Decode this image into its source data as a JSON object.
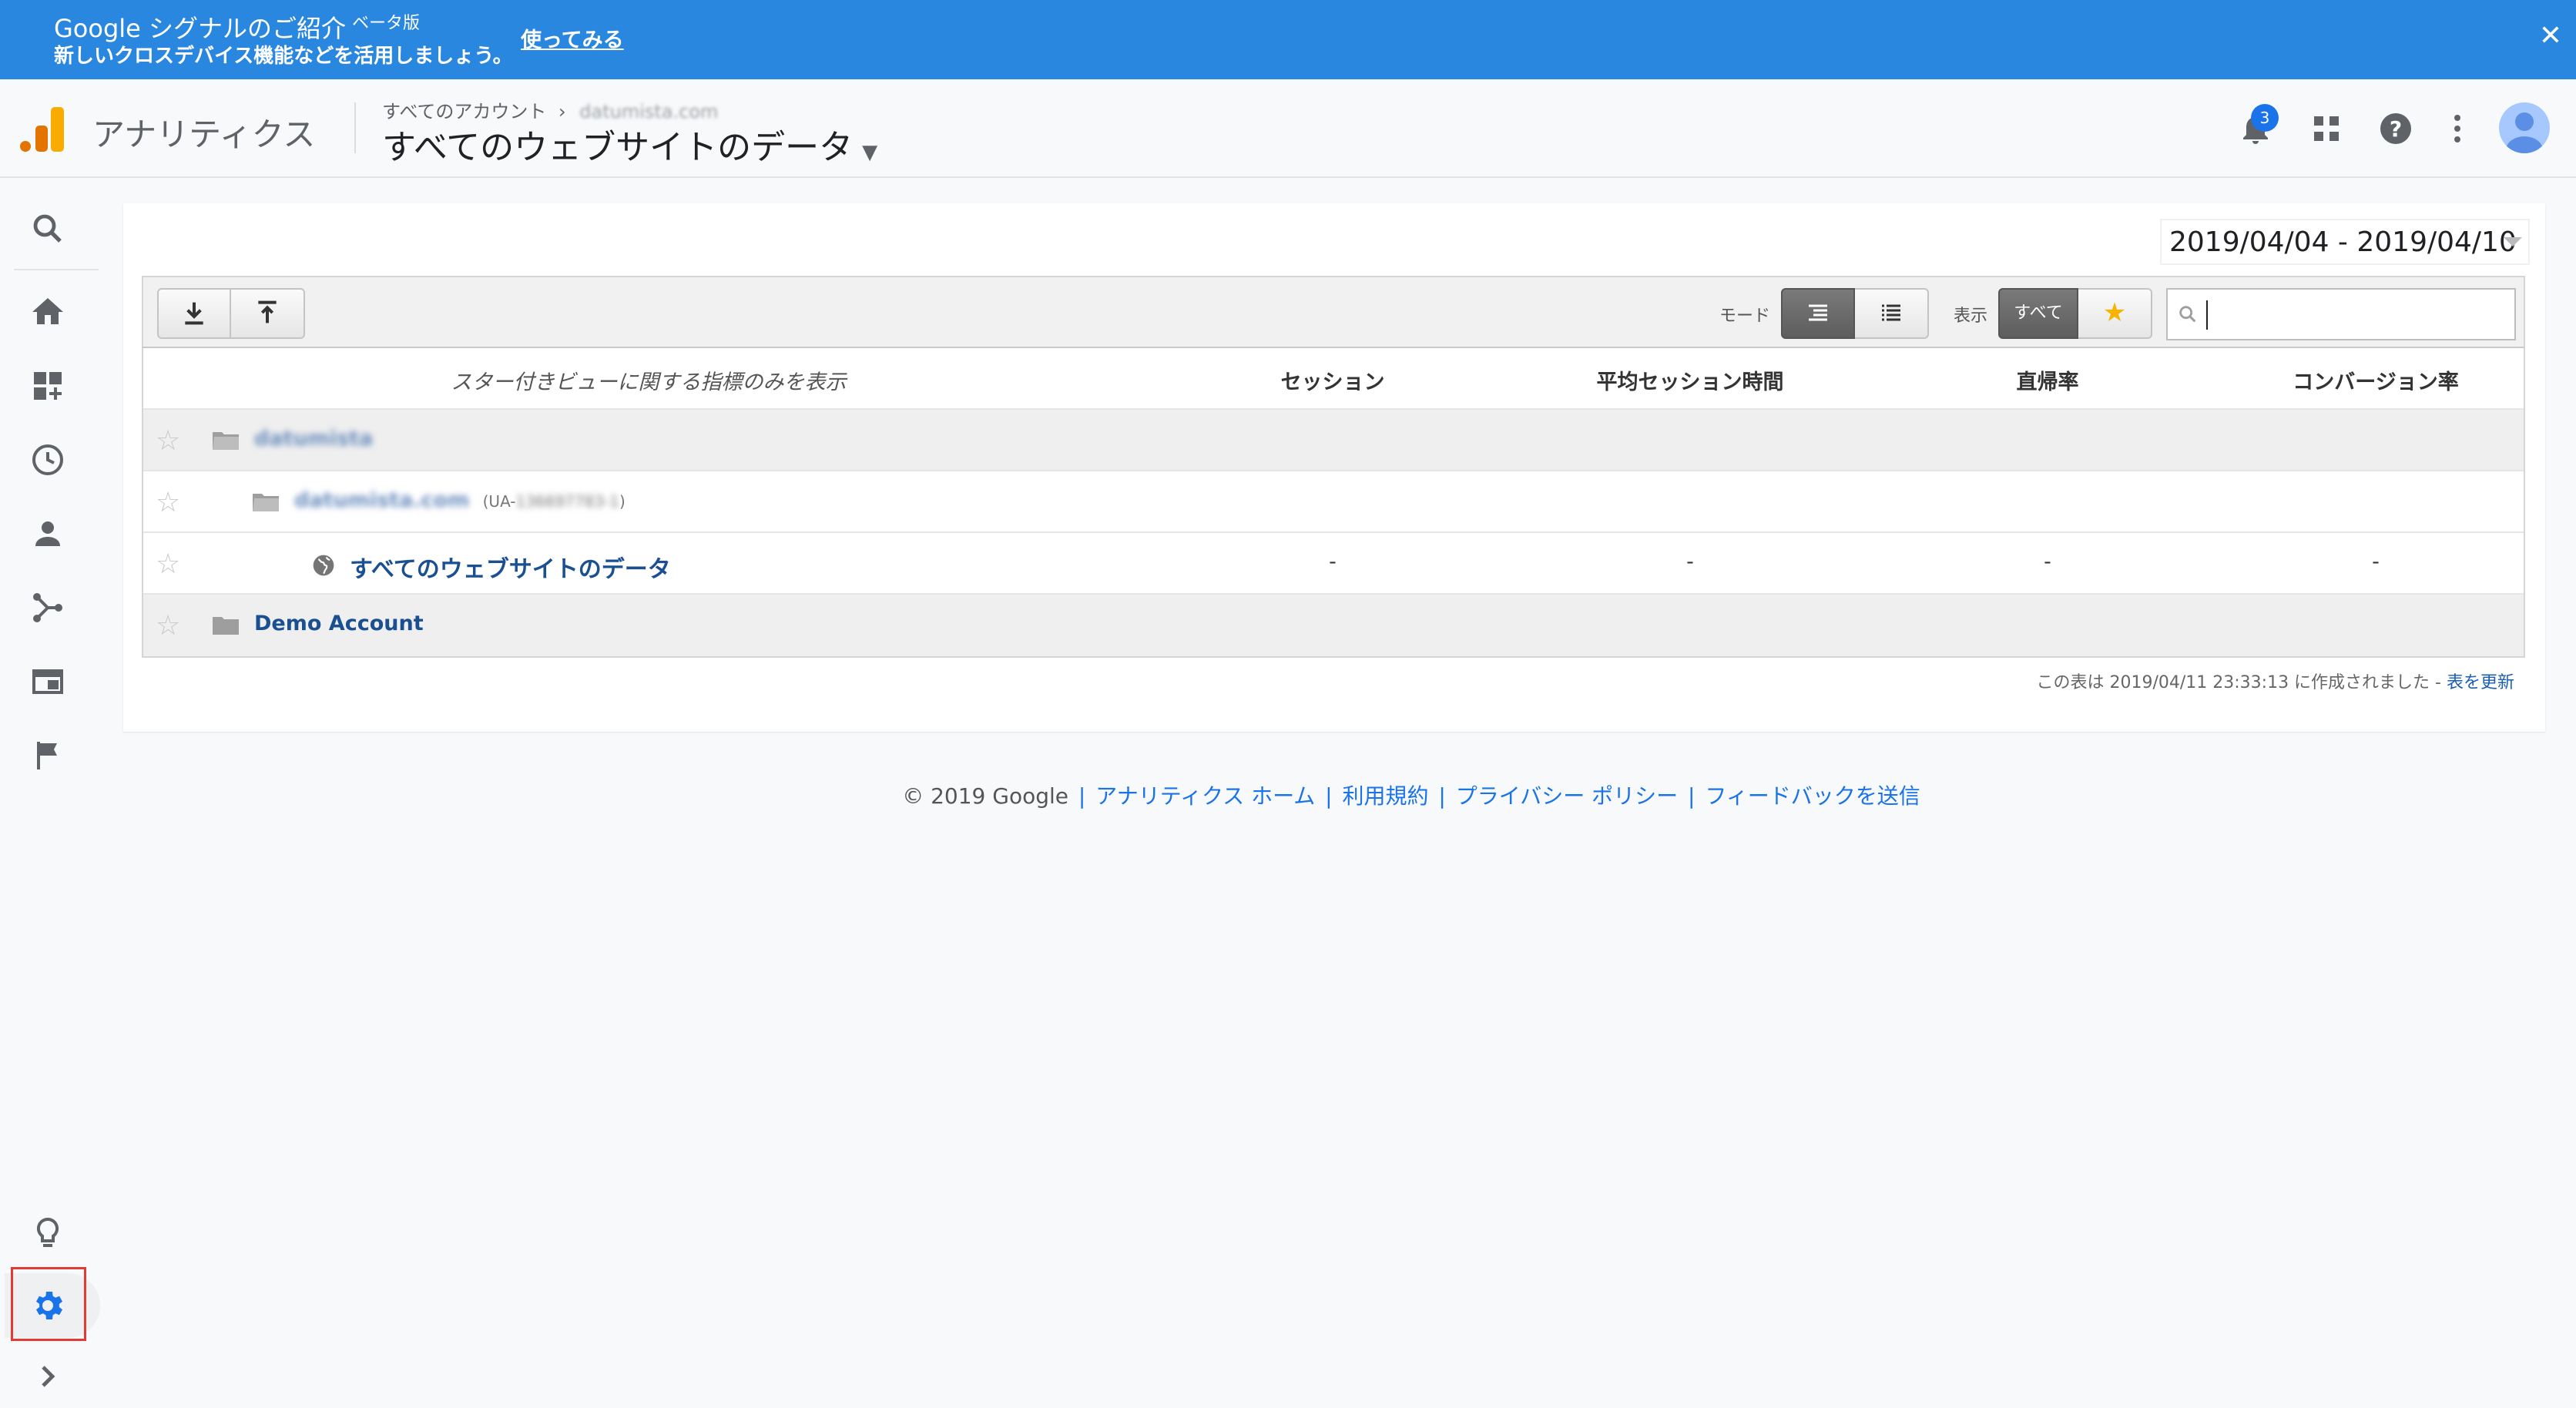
{
  "banner": {
    "title": "Google シグナルのご紹介",
    "beta": "ベータ版",
    "subtitle": "新しいクロスデバイス機能などを活用しましょう。",
    "cta": "使ってみる",
    "close": "✕"
  },
  "header": {
    "app_name": "アナリティクス",
    "breadcrumb_root": "すべてのアカウント",
    "breadcrumb_sep": "›",
    "breadcrumb_account": "datumista.com",
    "view_title": "すべてのウェブサイトのデータ",
    "notification_count": "3"
  },
  "date_range": "2019/04/04 - 2019/04/10",
  "toolbar": {
    "mode_label": "モード",
    "show_label": "表示",
    "show_all": "すべて",
    "search_placeholder": ""
  },
  "table": {
    "hint": "スター付きビューに関する指標のみを表示",
    "columns": [
      "セッション",
      "平均セッション時間",
      "直帰率",
      "コンバージョン率"
    ],
    "rows": [
      {
        "name": "datumista",
        "type": "account"
      },
      {
        "name": "datumista.com",
        "property_id": "(UA-",
        "property_id_blurred": "136697783-1",
        "property_close": ")",
        "type": "property"
      },
      {
        "name": "すべてのウェブサイトのデータ",
        "type": "view",
        "values": [
          "-",
          "-",
          "-",
          "-"
        ]
      },
      {
        "name": "Demo Account",
        "type": "account"
      }
    ],
    "footnote_prefix": "この表は 2019/04/11 23:33:13 に作成されました - ",
    "refresh_link": "表を更新"
  },
  "footer": {
    "copyright": "© 2019 Google",
    "links": [
      "アナリティクス ホーム",
      "利用規約",
      "プライバシー ポリシー",
      "フィードバックを送信"
    ],
    "sep": "|"
  },
  "colors": {
    "banner": "#2a87e0",
    "accent": "#1a73e8",
    "logo_orange": "#f9ab00",
    "logo_dark_orange": "#e37400",
    "highlight_box": "#e53935"
  },
  "icons": {
    "nav": [
      "search-icon",
      "home-icon",
      "customization-icon",
      "realtime-clock-icon",
      "audience-person-icon",
      "acquisition-icon",
      "behavior-icon",
      "conversions-flag-icon",
      "discover-bulb-icon",
      "admin-gear-icon",
      "expand-chevron-icon"
    ]
  }
}
